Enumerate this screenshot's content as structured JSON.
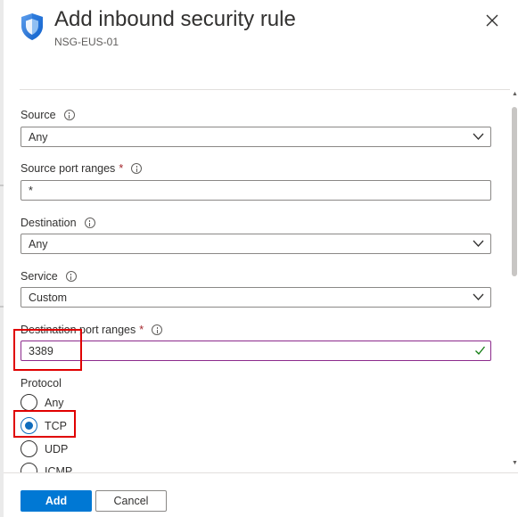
{
  "panel": {
    "title": "Add inbound security rule",
    "subtitle": "NSG-EUS-01",
    "brand_color": "#0078d4"
  },
  "form": {
    "source": {
      "label": "Source",
      "value": "Any"
    },
    "source_port_ranges": {
      "label": "Source port ranges",
      "required": "*",
      "value": "*"
    },
    "destination": {
      "label": "Destination",
      "value": "Any"
    },
    "service": {
      "label": "Service",
      "value": "Custom"
    },
    "destination_port_ranges": {
      "label": "Destination port ranges",
      "required": "*",
      "value": "3389"
    },
    "protocol": {
      "label": "Protocol",
      "options": [
        "Any",
        "TCP",
        "UDP",
        "ICMP"
      ],
      "selected": "TCP"
    }
  },
  "footer": {
    "add_label": "Add",
    "cancel_label": "Cancel"
  },
  "colors": {
    "highlight": "#e00000",
    "valid_check": "#107c10",
    "radio_selected": "#0f6cbd"
  }
}
